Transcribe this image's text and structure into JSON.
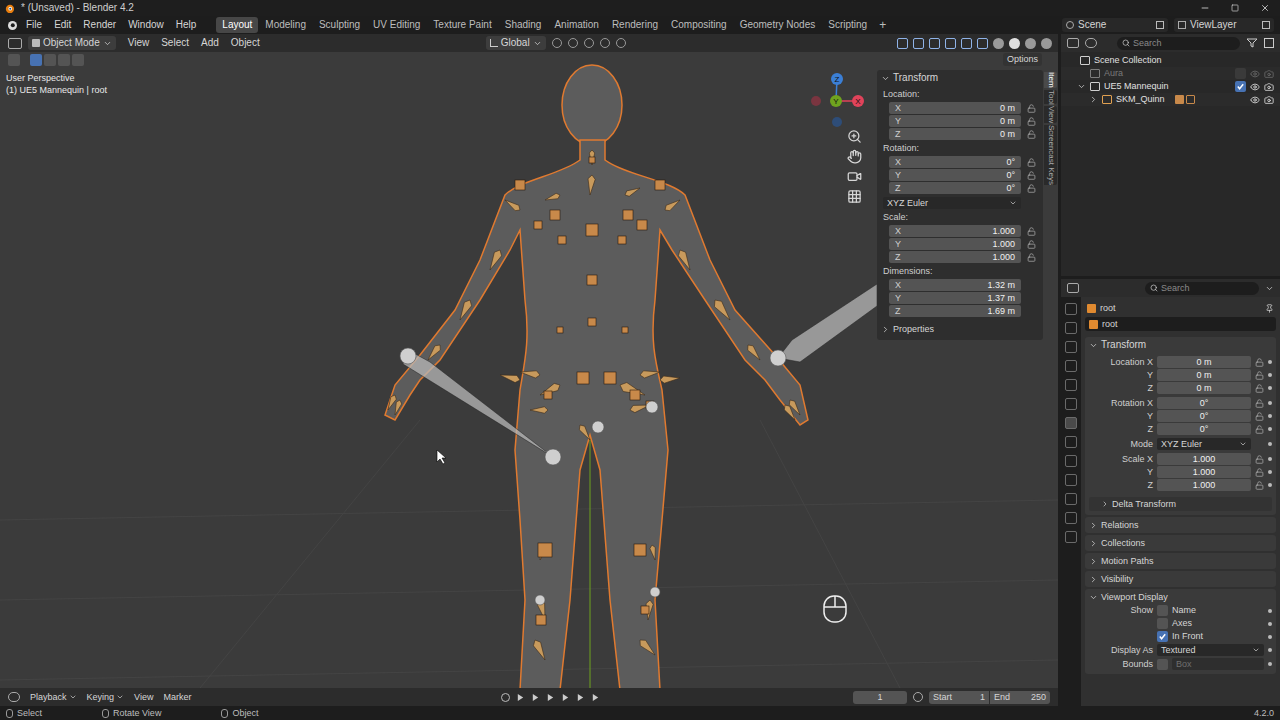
{
  "window": {
    "title": "* (Unsaved) - Blender 4.2"
  },
  "topbar": {
    "menus": [
      "File",
      "Edit",
      "Render",
      "Window",
      "Help"
    ],
    "workspaces": [
      {
        "label": "Layout",
        "selected": true
      },
      {
        "label": "Modeling",
        "selected": false
      },
      {
        "label": "Sculpting",
        "selected": false
      },
      {
        "label": "UV Editing",
        "selected": false
      },
      {
        "label": "Texture Paint",
        "selected": false
      },
      {
        "label": "Shading",
        "selected": false
      },
      {
        "label": "Animation",
        "selected": false
      },
      {
        "label": "Rendering",
        "selected": false
      },
      {
        "label": "Compositing",
        "selected": false
      },
      {
        "label": "Geometry Nodes",
        "selected": false
      },
      {
        "label": "Scripting",
        "selected": false
      }
    ],
    "add": "+",
    "scene": "Scene",
    "view_layer": "ViewLayer"
  },
  "viewport": {
    "mode": "Object Mode",
    "menus": [
      "View",
      "Select",
      "Add",
      "Object"
    ],
    "orientation": "Global",
    "options": "Options",
    "overlay_text": [
      "User Perspective",
      "(1) UE5 Mannequin | root"
    ],
    "gizmo": [
      {
        "label": "Z",
        "color": "#3b7fd6"
      },
      {
        "label": "Y",
        "color": "#6fa31f"
      },
      {
        "label": "X",
        "color": "#e0435a"
      }
    ]
  },
  "sidebar": {
    "title": "Transform",
    "tabs": [
      {
        "label": "Item",
        "selected": true
      },
      {
        "label": "Tool",
        "selected": false
      },
      {
        "label": "View",
        "selected": false
      },
      {
        "label": "Screencast Keys",
        "selected": false
      }
    ],
    "groups": [
      {
        "label": "Location:",
        "rows": [
          {
            "axis": "X",
            "value": "0 m",
            "locked": false
          },
          {
            "axis": "Y",
            "value": "0 m",
            "locked": false
          },
          {
            "axis": "Z",
            "value": "0 m",
            "locked": false
          }
        ]
      },
      {
        "label": "Rotation:",
        "rows": [
          {
            "axis": "X",
            "value": "0°",
            "locked": false
          },
          {
            "axis": "Y",
            "value": "0°",
            "locked": false
          },
          {
            "axis": "Z",
            "value": "0°",
            "locked": false
          }
        ],
        "mode": "XYZ Euler"
      },
      {
        "label": "Scale:",
        "rows": [
          {
            "axis": "X",
            "value": "1.000",
            "locked": false
          },
          {
            "axis": "Y",
            "value": "1.000",
            "locked": false
          },
          {
            "axis": "Z",
            "value": "1.000",
            "locked": false
          }
        ]
      },
      {
        "label": "Dimensions:",
        "rows": [
          {
            "axis": "X",
            "value": "1.32 m"
          },
          {
            "axis": "Y",
            "value": "1.37 m"
          },
          {
            "axis": "Z",
            "value": "1.69 m"
          }
        ]
      }
    ],
    "properties": "Properties"
  },
  "outliner": {
    "search": "Search",
    "items": [
      {
        "label": "Scene Collection",
        "kind": "scene",
        "disabled": false
      },
      {
        "label": "Aura",
        "kind": "collection",
        "disabled": true,
        "checked": false
      },
      {
        "label": "UE5 Mannequin",
        "kind": "collection",
        "disabled": false,
        "checked": true,
        "expanded": true
      },
      {
        "label": "SKM_Quinn",
        "kind": "object",
        "disabled": false,
        "expanded": false
      }
    ]
  },
  "properties": {
    "search": "Search",
    "object": "root",
    "data_name": "root",
    "transform": {
      "title": "Transform",
      "expanded": true,
      "groups": [
        [
          {
            "label": "Location X",
            "value": "0 m",
            "kind": "number",
            "locked": false
          },
          {
            "label": "Y",
            "value": "0 m",
            "kind": "number",
            "locked": false
          },
          {
            "label": "Z",
            "value": "0 m",
            "kind": "number",
            "locked": false
          }
        ],
        [
          {
            "label": "Rotation X",
            "value": "0°",
            "kind": "number",
            "locked": false
          },
          {
            "label": "Y",
            "value": "0°",
            "kind": "number",
            "locked": false
          },
          {
            "label": "Z",
            "value": "0°",
            "kind": "number",
            "locked": false
          }
        ],
        [
          {
            "label": "Mode",
            "value": "XYZ Euler",
            "kind": "dropdown"
          }
        ],
        [
          {
            "label": "Scale X",
            "value": "1.000",
            "kind": "number",
            "locked": false
          },
          {
            "label": "Y",
            "value": "1.000",
            "kind": "number",
            "locked": false
          },
          {
            "label": "Z",
            "value": "1.000",
            "kind": "number",
            "locked": false
          }
        ]
      ]
    },
    "sections": [
      {
        "title": "Delta Transform",
        "expanded": false,
        "sub": true
      },
      {
        "title": "Relations",
        "expanded": false,
        "sub": false
      },
      {
        "title": "Collections",
        "expanded": false,
        "sub": false
      },
      {
        "title": "Motion Paths",
        "expanded": false,
        "sub": false
      },
      {
        "title": "Visibility",
        "expanded": false,
        "sub": false
      },
      {
        "title": "Viewport Display",
        "expanded": true,
        "sub": false
      }
    ],
    "viewport_display": [
      {
        "label": "Show",
        "option": "Name",
        "kind": "checkbox",
        "checked": false
      },
      {
        "label": "",
        "option": "Axes",
        "kind": "checkbox",
        "checked": false
      },
      {
        "label": "",
        "option": "In Front",
        "kind": "checkbox",
        "checked": true
      },
      {
        "label": "Display As",
        "option": "Textured",
        "kind": "dropdown"
      },
      {
        "label": "Bounds",
        "option": "Box",
        "kind": "bounds",
        "checked": false,
        "disabled": true
      }
    ]
  },
  "timeline": {
    "menus": [
      "Playback",
      "Keying",
      "View",
      "Marker"
    ],
    "frame": "1",
    "start_label": "Start",
    "start": "1",
    "end_label": "End",
    "end": "250"
  },
  "status": {
    "items": [
      "Select",
      "Rotate View",
      "Object"
    ],
    "version": "4.2.0"
  }
}
